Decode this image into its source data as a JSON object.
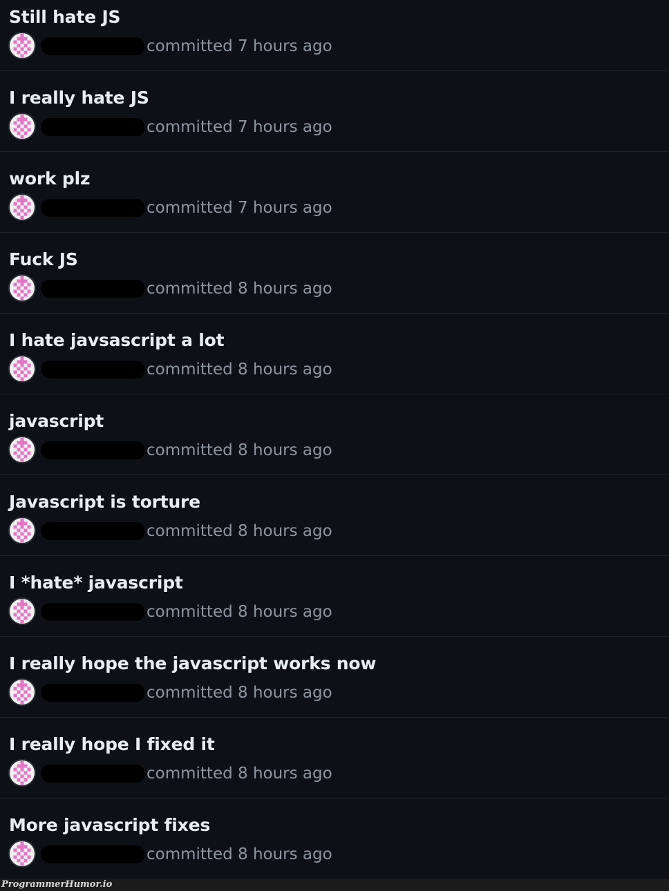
{
  "commits": [
    {
      "title": "Still hate JS",
      "verb": "committed",
      "time": "7 hours ago"
    },
    {
      "title": "I really hate JS",
      "verb": "committed",
      "time": "7 hours ago"
    },
    {
      "title": "work plz",
      "verb": "committed",
      "time": "7 hours ago"
    },
    {
      "title": "Fuck JS",
      "verb": "committed",
      "time": "8 hours ago"
    },
    {
      "title": "I hate javsascript a lot",
      "verb": "committed",
      "time": "8 hours ago"
    },
    {
      "title": "javascript",
      "verb": "committed",
      "time": "8 hours ago"
    },
    {
      "title": "Javascript is torture",
      "verb": "committed",
      "time": "8 hours ago"
    },
    {
      "title": "I *hate* javascript",
      "verb": "committed",
      "time": "8 hours ago"
    },
    {
      "title": "I really hope the javascript works now",
      "verb": "committed",
      "time": "8 hours ago"
    },
    {
      "title": "I really hope I fixed it",
      "verb": "committed",
      "time": "8 hours ago"
    },
    {
      "title": "More javascript fixes",
      "verb": "committed",
      "time": "8 hours ago"
    }
  ],
  "avatar": {
    "icon": "identicon",
    "color": "#e375c6",
    "background": "#f0f0f0"
  },
  "colors": {
    "background": "#0d1117",
    "title": "#e6edf3",
    "meta": "#8d96a0",
    "divider": "#21262d"
  },
  "footer": {
    "watermark": "ProgrammerHumor.io"
  }
}
